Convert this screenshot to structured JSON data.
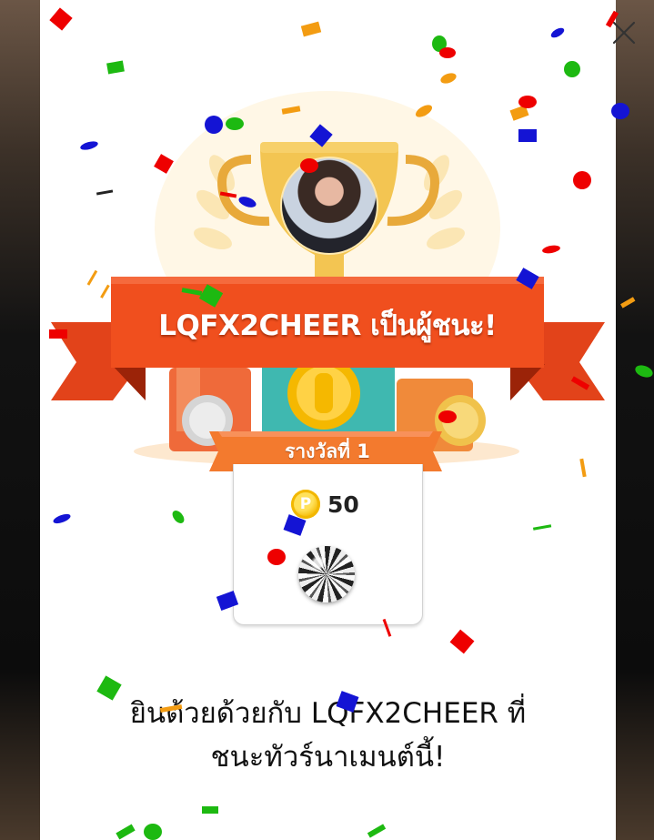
{
  "dialog": {
    "close_label": "×",
    "winner_banner": "LQFX2CHEER เป็นผู้ชนะ!",
    "rank_label": "รางวัลที่ 1",
    "reward": {
      "coin_symbol": "P",
      "coin_amount": "50",
      "items": [
        "coin-reward-icon",
        "bowling-ball-reward-icon"
      ]
    },
    "congrats_line1": "ยินต้วยด้วยกับ LQFX2CHEER ที่",
    "congrats_line2": "ชนะทัวร์นาเมนต์นี้!"
  },
  "colors": {
    "banner": "#f04f1e",
    "banner_dark": "#c6300f",
    "rank_ribbon": "#f37a2e",
    "coin": "#f5b800",
    "trophy": "#f3c552"
  }
}
